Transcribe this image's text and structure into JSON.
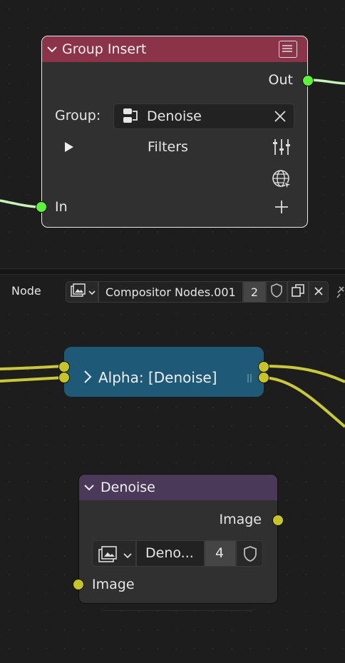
{
  "top_node": {
    "title": "Group Insert",
    "out_label": "Out",
    "group_label": "Group:",
    "group_value": "Denoise",
    "filters_label": "Filters",
    "in_label": "In"
  },
  "bottom_header": {
    "mode_label": "Node",
    "tree_name": "Compositor Nodes.001",
    "users_count": "2"
  },
  "alpha_node": {
    "title": "Alpha: [Denoise]"
  },
  "denoise_node": {
    "title": "Denoise",
    "output_label": "Image",
    "input_label": "Image",
    "datablock_name": "Deno...",
    "users_count": "4"
  },
  "colors": {
    "group_header": "#8b3449",
    "denoise_header": "#4a3958",
    "alpha_node": "#1e5a78",
    "socket_green": "#5ef23c",
    "socket_yellow": "#c7c429",
    "wire_green": "#c6f5b8",
    "wire_yellow": "#c9c83a"
  },
  "icons": [
    "chevron-down-icon",
    "list-icon",
    "node-tree-icon",
    "close-icon",
    "play-icon",
    "sliders-icon",
    "globe-icon",
    "plus-icon",
    "image-icon",
    "shield-icon",
    "duplicate-icon",
    "chevron-right-icon",
    "pin-icon"
  ]
}
